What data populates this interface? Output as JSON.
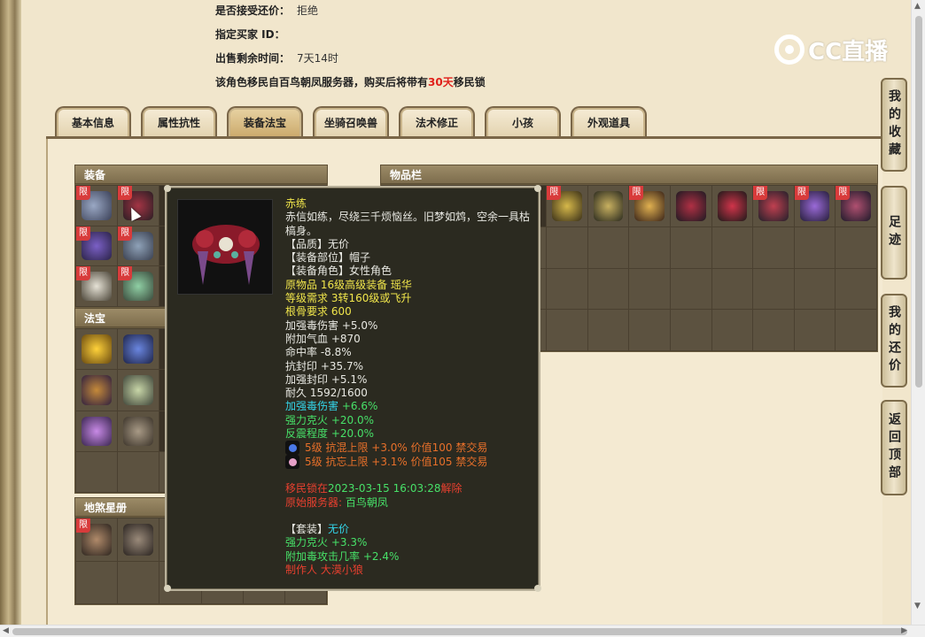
{
  "info": {
    "accept_bargain_label": "是否接受还价：",
    "accept_bargain_value": "拒绝",
    "buyer_id_label": "指定买家 ID：",
    "buyer_id_value": "",
    "remaining_label": "出售剩余时间：",
    "remaining_value": "7天14时",
    "migrate_prefix": "该角色移民自百鸟朝凤服务器，购买后将带有",
    "migrate_days": "30天",
    "migrate_suffix": "移民锁"
  },
  "logo_text": "CC直播",
  "tabs": [
    {
      "label": "基本信息"
    },
    {
      "label": "属性抗性"
    },
    {
      "label": "装备法宝",
      "active": true
    },
    {
      "label": "坐骑召唤兽"
    },
    {
      "label": "法术修正"
    },
    {
      "label": "小孩"
    },
    {
      "label": "外观道具"
    }
  ],
  "sections": {
    "equipment": "装备",
    "inventory": "物品栏",
    "treasure": "法宝",
    "star_book": "地煞星册"
  },
  "limit_badge": "限",
  "side_buttons": {
    "favorites": "我的收藏",
    "footprint": "足迹",
    "my_bargain": "我的还价",
    "back_top": "返回顶部"
  },
  "tooltip": {
    "name": "赤练",
    "desc": "赤信如练，尽绕三千烦恼丝。旧梦如鸩，空余一具枯槁身。",
    "quality": "【品质】无价",
    "slot": "【装备部位】帽子",
    "role": "【装备角色】女性角色",
    "origin": "原物品 16级高级装备 瑶华",
    "level_req": "等级需求 3转160级或飞升",
    "bone_req": "根骨要求 600",
    "lines_white": [
      "加强毒伤害 +5.0%",
      "附加气血 +870",
      "命中率 -8.8%",
      "抗封印 +35.7%",
      "加强封印 +5.1%",
      "耐久 1592/1600"
    ],
    "bonus_cyan_label": "加强毒伤害",
    "bonus_cyan_value": "+6.6%",
    "lines_green": [
      "强力克火 +20.0%",
      "反震程度 +20.0%"
    ],
    "gems": [
      {
        "text": "5级 抗混上限 +3.0% 价值100 禁交易",
        "color": "#4a78e6"
      },
      {
        "text": "5级 抗忘上限 +3.1% 价值105 禁交易",
        "color": "#e6a0c8"
      }
    ],
    "migrate_lock_label": "移民锁在",
    "migrate_lock_time": "2023-03-15 16:03:28",
    "migrate_lock_end": "解除",
    "origin_server_label": "原始服务器:",
    "origin_server_value": "百鸟朝凤",
    "set_label": "【套装】",
    "set_value": "无价",
    "set_lines": [
      "强力克火 +3.3%",
      "附加毒攻击几率 +2.4%"
    ],
    "maker": "制作人 大漠小狼"
  }
}
